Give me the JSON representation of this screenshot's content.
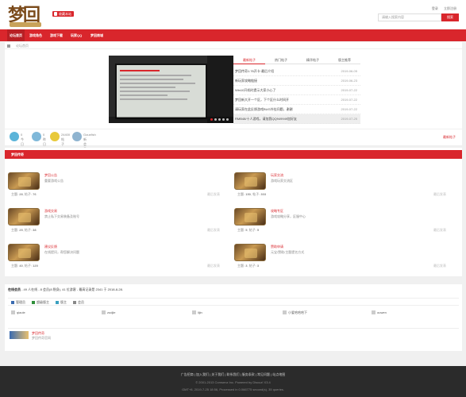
{
  "header": {
    "fav_label": "收藏本站",
    "links": [
      "登录",
      "立即注册"
    ],
    "search_placeholder": "请输入搜索内容",
    "search_button": "搜索"
  },
  "nav": [
    "论坛首页",
    "游戏角色",
    "游戏下载",
    "玩家QQ",
    "梦回商城"
  ],
  "breadcrumb": "论坛首页",
  "tabs": [
    "最新帖子",
    "热门帖子",
    "精华帖子",
    "版主推荐"
  ],
  "news": [
    {
      "title": "梦回传奇1.76开卡·最后介绍",
      "date": "2019-06-05"
    },
    {
      "title": "新玩家攻略链接",
      "date": "2019-06-23"
    },
    {
      "title": "Win10开机时提示大家小心了",
      "date": "2019-07-22"
    },
    {
      "title": "梦回新大开一个区，下个区什么时间开",
      "date": "2019-07-22"
    },
    {
      "title": "请玩家在此反馈游戏BUG外挂问题，谢谢",
      "date": "2019-07-22"
    },
    {
      "title": "RMB48/十人游戏，请加我QQ949949加好友",
      "date": "2019-07-25"
    }
  ],
  "stats": [
    {
      "name": "今日",
      "value": "0",
      "color": "#5bb4d9"
    },
    {
      "name": "昨日",
      "value": "0",
      "color": "#7fb8d9"
    },
    {
      "name": "帖子",
      "value": "24400",
      "color": "#e8c93a"
    },
    {
      "name": "Gouxfish",
      "value": "新会员",
      "color": "#8fb4d0"
    }
  ],
  "latest_link": "最新帖子",
  "section_title": "梦回传奇",
  "forums": [
    {
      "name": "梦回公告",
      "desc": "重要游戏公告",
      "topics": "28",
      "posts": "76",
      "last": "最后发表"
    },
    {
      "name": "玩家交流",
      "desc": "游戏玩家交流区",
      "topics": "150",
      "posts": "303",
      "last": "最后发表"
    },
    {
      "name": "游戏交易",
      "desc": "禁止私下交易装备及账号",
      "topics": "25",
      "posts": "38",
      "last": "最后发表"
    },
    {
      "name": "攻略专区",
      "desc": "游戏攻略分享，区服中心",
      "topics": "5",
      "posts": "5",
      "last": "最后发表"
    },
    {
      "name": "建议反馈",
      "desc": "在线提问，帮您解决问题",
      "topics": "40",
      "posts": "120",
      "last": "最后发表"
    },
    {
      "name": "赞助申请",
      "desc": "元宝/赞助/主题提名方式",
      "topics": "3",
      "posts": "3",
      "last": "最后发表"
    }
  ],
  "online": {
    "label": "在线会员",
    "text": " - 49 人在线 - 8 会员(8 隐身), 41 位游客 - 最高记录是 2341 于 2018-8-28."
  },
  "groups": [
    {
      "name": "管理员",
      "color": "#3a6bb0"
    },
    {
      "name": "超级版主",
      "color": "#2f8f3a"
    },
    {
      "name": "版主",
      "color": "#3aa0c0"
    },
    {
      "name": "会员",
      "color": "#888888"
    }
  ],
  "users": [
    "qiaole",
    "zudjie",
    "lijin",
    "小爱哈哈哈下",
    "ouwen"
  ],
  "brand": {
    "title": "梦回传奇",
    "desc": "梦回传奇官网"
  },
  "footer": {
    "links": "广告招商 | 加入我们 | 关于我们 | 联系我们 | 服务条款 | 常见问题 | 站点地图",
    "copyright": "© 2001-2013 Comsenz Inc. Powered by Discuz! X3.4",
    "processed": "GMT+8, 2019-7-25 18:56, Processed in 0.066775 second(s), 35 queries."
  }
}
